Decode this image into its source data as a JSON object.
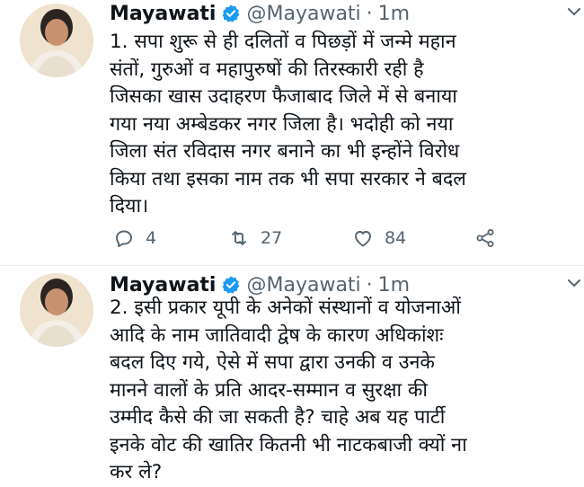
{
  "tweets": [
    {
      "name": "Mayawati",
      "handle": "@Mayawati",
      "separator": "·",
      "time": "1m",
      "text": "1. सपा शुरू से ही दलितों व पिछड़ों में जन्मे महान\nसंतों, गुरुओं व महापुरुषों की तिरस्कारी रही है\nजिसका खास उदाहरण फैजाबाद जिले में से बनाया\nगया नया अम्बेडकर नगर जिला है। भदोही को नया\nजिला संत रविदास नगर बनाने का भी इन्होंने विरोध\nकिया तथा इसका नाम तक भी सपा सरकार ने बदल\nदिया।",
      "replies": "4",
      "retweets": "27",
      "likes": "84"
    },
    {
      "name": "Mayawati",
      "handle": "@Mayawati",
      "separator": "·",
      "time": "1m",
      "text": "2. इसी प्रकार यूपी के अनेकों संस्थानों व योजनाओं\nआदि के नाम जातिवादी द्वेष के कारण अधिकांशः\nबदल दिए गये, ऐसे में सपा द्वारा उनकी व उनके\nमानने वालों के प्रति आदर-सम्मान व सुरक्षा की\nउम्मीद कैसे की जा सकती है? चाहे अब यह पार्टी\nइनके वोट की खातिर कितनी भी नाटकबाजी क्यों ना\nकर ले?"
    }
  ],
  "icons": {
    "verified": "verified-badge-icon",
    "caret": "chevron-down-icon",
    "reply": "reply-icon",
    "retweet": "retweet-icon",
    "like": "heart-icon",
    "share": "share-icon"
  },
  "colors": {
    "verified": "#1d9bf0",
    "secondary_text": "#536471",
    "primary_text": "#0f1419"
  }
}
